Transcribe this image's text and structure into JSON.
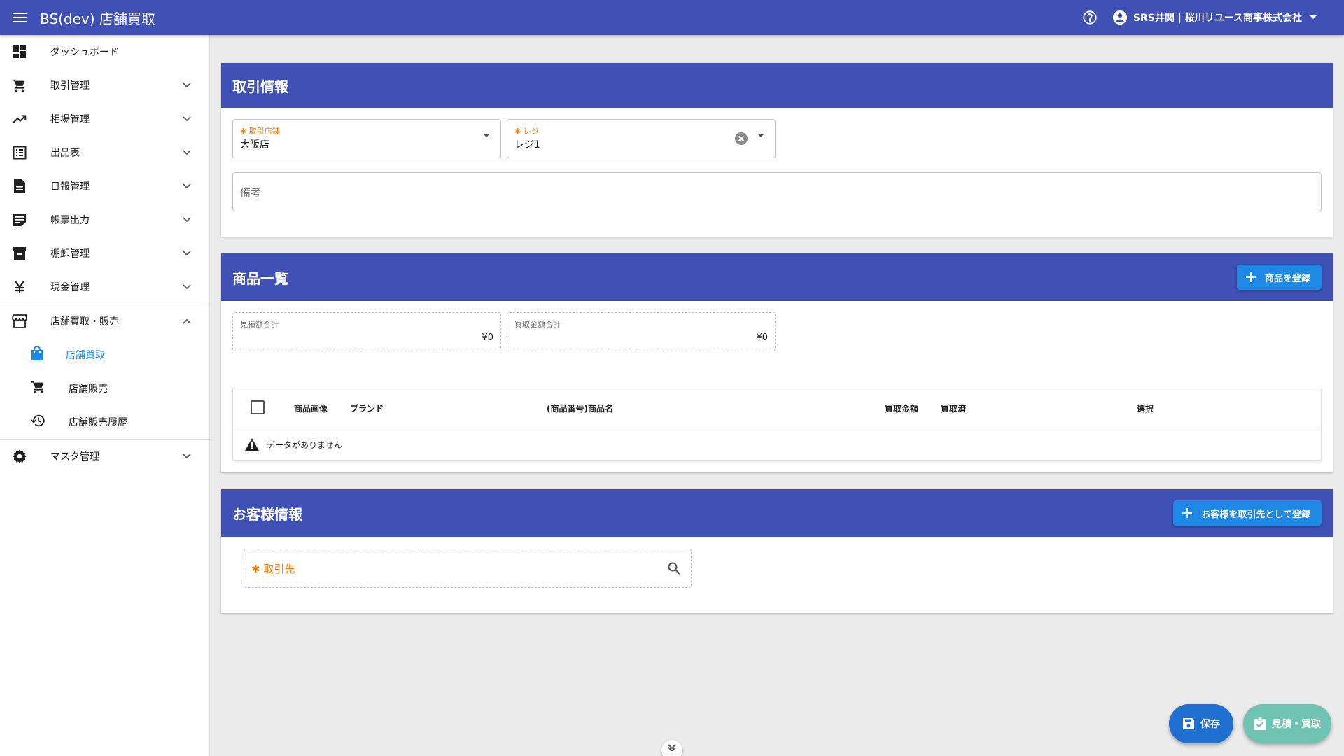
{
  "appbar": {
    "title": "BS(dev) 店舗買取",
    "user": "SRS井関 | 桜川リユース商事株式会社"
  },
  "sidebar": {
    "items": [
      {
        "label": "ダッシュボード",
        "icon": "dashboard-icon"
      },
      {
        "label": "取引管理",
        "icon": "cart-icon"
      },
      {
        "label": "相場管理",
        "icon": "trending-up-icon"
      },
      {
        "label": "出品表",
        "icon": "list-icon"
      },
      {
        "label": "日報管理",
        "icon": "document-icon"
      },
      {
        "label": "帳票出力",
        "icon": "form-icon"
      },
      {
        "label": "棚卸管理",
        "icon": "archive-icon"
      },
      {
        "label": "現金管理",
        "icon": "yen-icon"
      },
      {
        "label": "店舗買取・販売",
        "icon": "store-icon"
      },
      {
        "label": "マスタ管理",
        "icon": "gear-icon"
      }
    ],
    "sub_items": [
      {
        "label": "店舗買取",
        "icon": "shopping-bag-icon",
        "active": true
      },
      {
        "label": "店舗販売",
        "icon": "cart-icon"
      },
      {
        "label": "店舗販売履歴",
        "icon": "history-icon"
      }
    ]
  },
  "transaction": {
    "title": "取引情報",
    "store_label": "取引店舗",
    "store_value": "大阪店",
    "register_label": "レジ",
    "register_value": "レジ1",
    "remarks_placeholder": "備考"
  },
  "products": {
    "title": "商品一覧",
    "register_button": "商品を登録",
    "estimate_total_label": "見積額合計",
    "estimate_total_value": "¥0",
    "purchase_total_label": "買取金額合計",
    "purchase_total_value": "¥0",
    "columns": [
      "商品画像",
      "ブランド",
      "(商品番号)商品名",
      "買取金額",
      "買取済",
      "選択"
    ],
    "no_data": "データがありません"
  },
  "customer": {
    "title": "お客様情報",
    "register_button": "お客様を取引先として登録",
    "partner_placeholder": "取引先"
  },
  "actions": {
    "save": "保存",
    "estimate_purchase": "見積・買取"
  },
  "colors": {
    "primary": "#3f51b5",
    "accent": "#1e88e5",
    "required": "#f57c00",
    "fab_secondary": "#6fc3b3"
  }
}
